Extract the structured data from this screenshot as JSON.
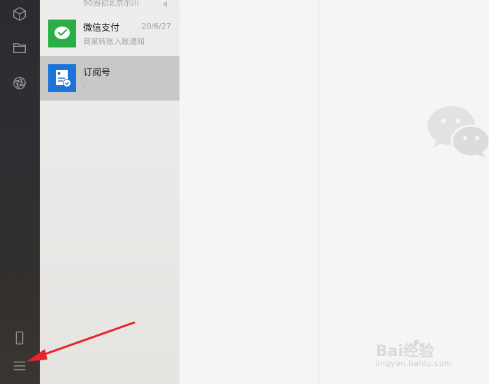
{
  "sidebar": {
    "icons": [
      {
        "name": "mini-program-icon"
      },
      {
        "name": "folder-icon"
      },
      {
        "name": "moments-icon"
      },
      {
        "name": "phone-icon"
      },
      {
        "name": "menu-icon"
      }
    ]
  },
  "chat_list": {
    "partial_top": {
      "subtitle": "90周初北京尔川"
    },
    "items": [
      {
        "title": "微信支付",
        "time": "20/6/27",
        "subtitle": "商家转账入账通知",
        "avatar_color": "#2aae45"
      },
      {
        "title": "订阅号",
        "time": "",
        "subtitle": ";",
        "avatar_color": "#1c73d9"
      }
    ]
  },
  "watermark": {
    "brand": "Bai经验",
    "url": "jingyan.baidu.com"
  },
  "colors": {
    "sidebar_bg": "#2e2f32",
    "list_bg": "#ebeae8",
    "selected_bg": "#c9c8c6",
    "arrow": "#e8232b"
  }
}
